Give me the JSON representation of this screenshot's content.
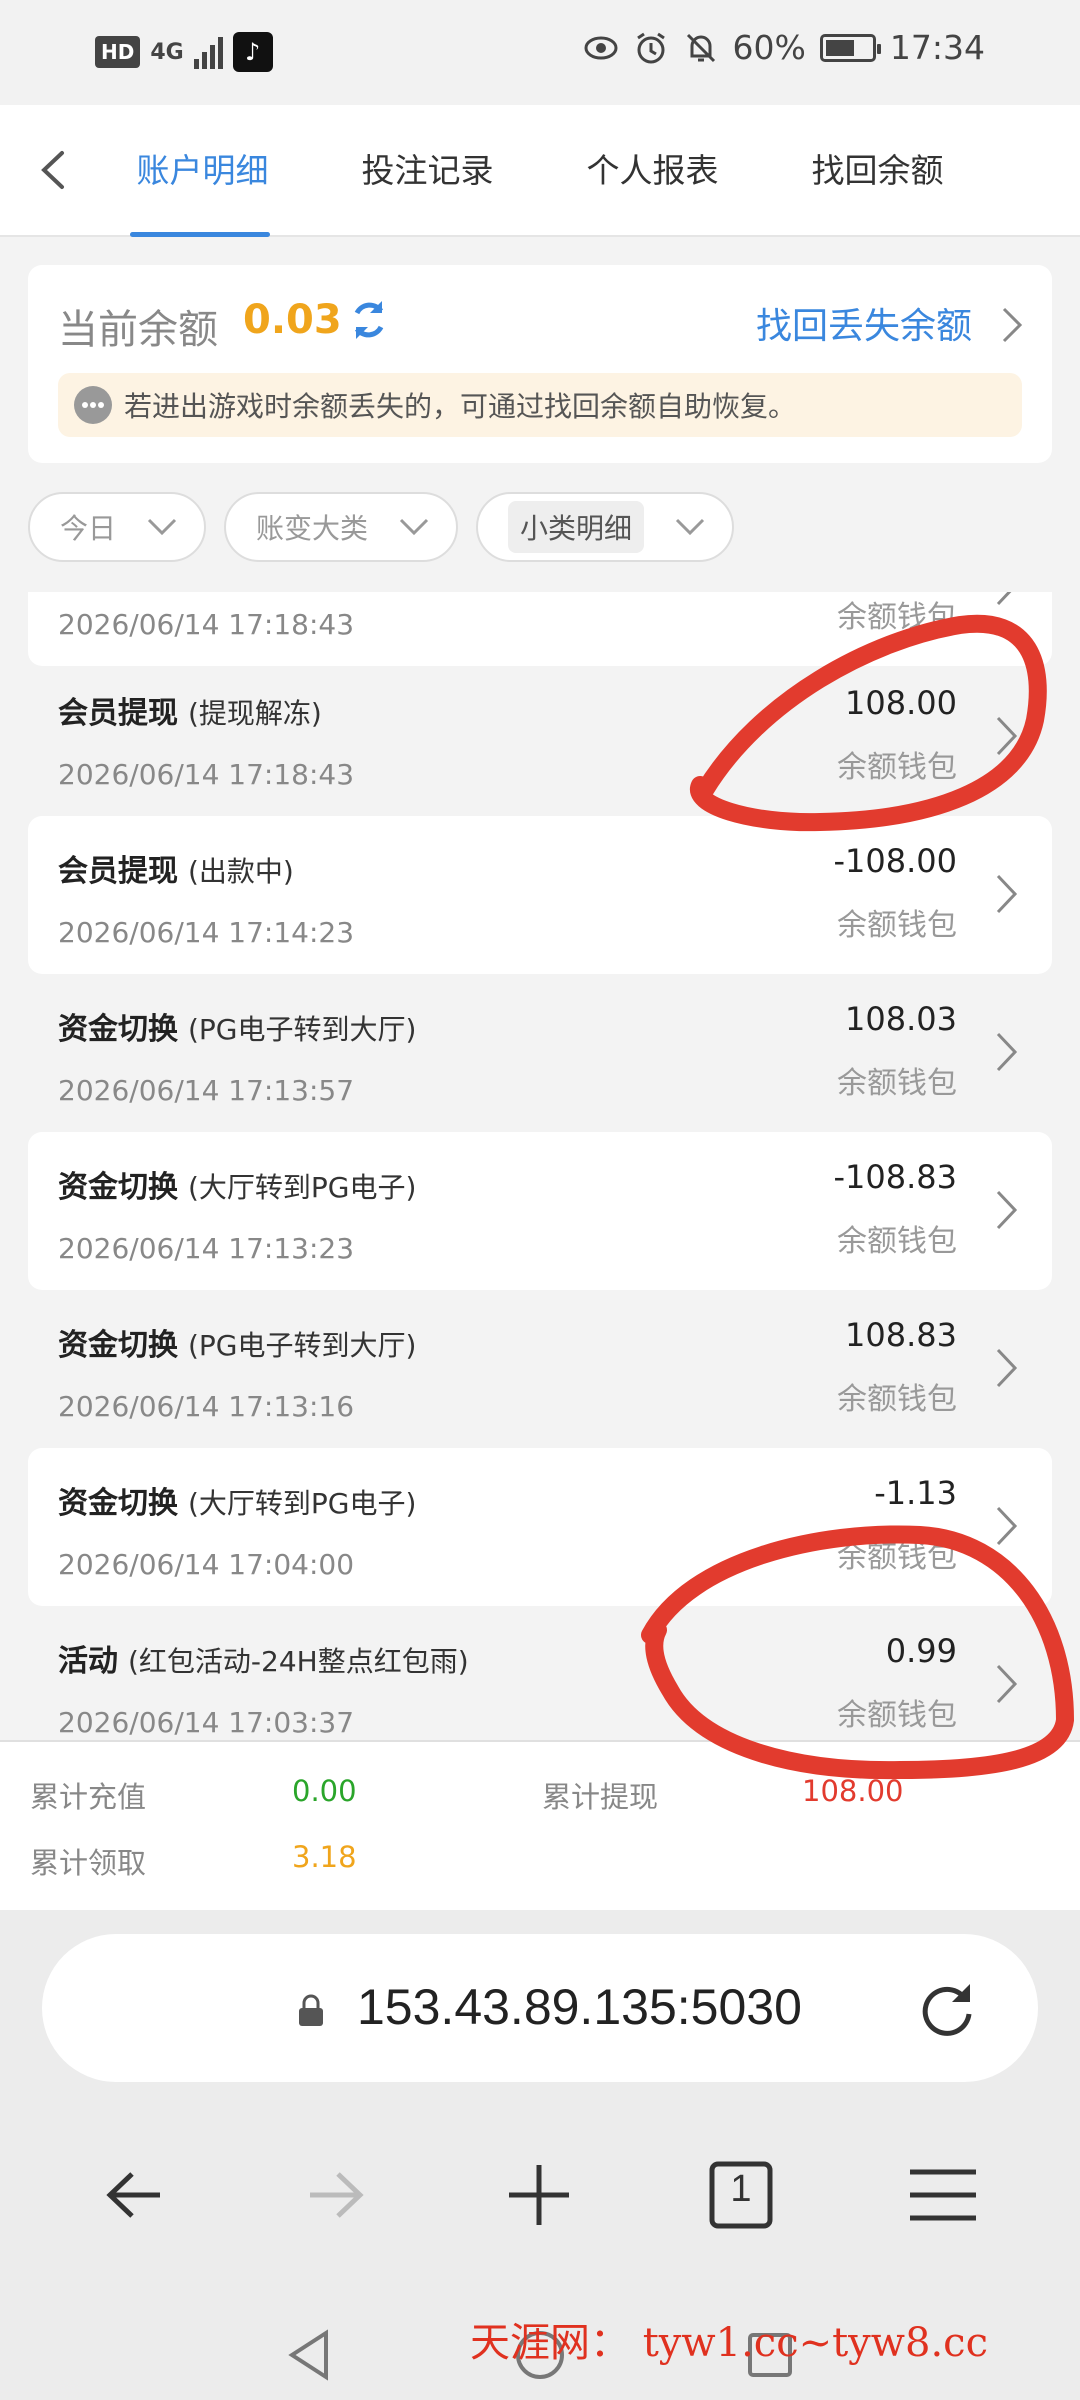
{
  "status": {
    "hd": "HD",
    "network": "4G",
    "battery": "60%",
    "time": "17:34"
  },
  "tabs": [
    "账户明细",
    "投注记录",
    "个人报表",
    "找回余额"
  ],
  "balance": {
    "label": "当前余额",
    "value": "0.03",
    "recover_link": "找回丢失余额",
    "notice": "若进出游戏时余额丢失的，可通过找回余额自助恢复。"
  },
  "filters": [
    "今日",
    "账变大类",
    "小类明细"
  ],
  "records": [
    {
      "title": "",
      "sub": "",
      "amount": "",
      "wallet": "余额钱包",
      "date": "2026/06/14 17:18:43"
    },
    {
      "title": "会员提现",
      "sub": "(提现解冻)",
      "amount": "108.00",
      "wallet": "余额钱包",
      "date": "2026/06/14 17:18:43"
    },
    {
      "title": "会员提现",
      "sub": "(出款中)",
      "amount": "-108.00",
      "wallet": "余额钱包",
      "date": "2026/06/14 17:14:23"
    },
    {
      "title": "资金切换",
      "sub": "(PG电子转到大厅)",
      "amount": "108.03",
      "wallet": "余额钱包",
      "date": "2026/06/14 17:13:57"
    },
    {
      "title": "资金切换",
      "sub": "(大厅转到PG电子)",
      "amount": "-108.83",
      "wallet": "余额钱包",
      "date": "2026/06/14 17:13:23"
    },
    {
      "title": "资金切换",
      "sub": "(PG电子转到大厅)",
      "amount": "108.83",
      "wallet": "余额钱包",
      "date": "2026/06/14 17:13:16"
    },
    {
      "title": "资金切换",
      "sub": "(大厅转到PG电子)",
      "amount": "-1.13",
      "wallet": "余额钱包",
      "date": "2026/06/14 17:04:00"
    },
    {
      "title": "活动",
      "sub": "(红包活动-24H整点红包雨)",
      "amount": "0.99",
      "wallet": "余额钱包",
      "date": "2026/06/14 17:03:37"
    }
  ],
  "totals": {
    "recharge_label": "累计充值",
    "recharge_value": "0.00",
    "withdraw_label": "累计提现",
    "withdraw_value": "108.00",
    "claim_label": "累计领取",
    "claim_value": "3.18"
  },
  "browser": {
    "url": "153.43.89.135:5030",
    "tab_count": "1"
  },
  "watermark": "天涯网： tyw1.cc~tyw8.cc",
  "colors": {
    "accent": "#3a87de",
    "balance": "#f0a51c",
    "green": "#2aa52a",
    "red_mark": "#e23b2e"
  }
}
